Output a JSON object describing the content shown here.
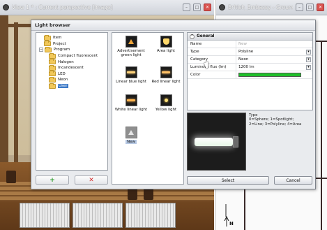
{
  "left_window": {
    "title": "View 1 * : Current perspective [image]"
  },
  "right_window": {
    "title": "British_Embassy - Ground..."
  },
  "dialog": {
    "title": "Light browser",
    "tree": [
      {
        "label": "Item",
        "expander": "",
        "indent": 1
      },
      {
        "label": "Project",
        "expander": "",
        "indent": 1
      },
      {
        "label": "Program",
        "expander": "−",
        "indent": 0
      },
      {
        "label": "Compact fluorescent",
        "expander": "",
        "indent": 2
      },
      {
        "label": "Halogen",
        "expander": "",
        "indent": 2
      },
      {
        "label": "Incandescent",
        "expander": "",
        "indent": 2
      },
      {
        "label": "LED",
        "expander": "",
        "indent": 2
      },
      {
        "label": "Neon",
        "expander": "",
        "indent": 2
      },
      {
        "label": "User",
        "expander": "",
        "indent": 2,
        "selected": true
      }
    ],
    "gallery": [
      {
        "label": "Advertisement green light",
        "icon": "triangle-light-icon"
      },
      {
        "label": "Area light",
        "icon": "area-light-icon"
      },
      {
        "label": "Linear blue light",
        "icon": "linear-light-icon"
      },
      {
        "label": "Red linear light",
        "icon": "linear-light-icon"
      },
      {
        "label": "White linear light",
        "icon": "linear-light-icon"
      },
      {
        "label": "Yellow light",
        "icon": "point-light-icon"
      },
      {
        "label": "New",
        "icon": "new-light-icon",
        "selected": true
      }
    ],
    "properties": {
      "section": "General",
      "collapse_symbol": "^",
      "rows": [
        {
          "name": "Name",
          "value": "New",
          "placeholder": true
        },
        {
          "name": "Type",
          "value": "Polyline",
          "combo": true
        },
        {
          "name": "Category",
          "value": "Neon",
          "combo": true
        },
        {
          "name": "Luminous flux (lm)",
          "value": "1200 lm",
          "combo": true
        },
        {
          "name": "Color",
          "value": "",
          "color": "#1fbf2a"
        }
      ]
    },
    "help_text": "Type\n0=Sphere; 1=Spotlight;\n2=Line; 3=Polyline; 4=Area",
    "buttons": {
      "add": "+",
      "delete": "✕",
      "select": "Select",
      "cancel": "Cancel"
    }
  },
  "compass": {
    "north": "N"
  },
  "colors": {
    "accent": "#3c79c7",
    "add_green": "#2e9d2e",
    "delete_red": "#d22b2b",
    "light_color": "#1fbf2a"
  }
}
